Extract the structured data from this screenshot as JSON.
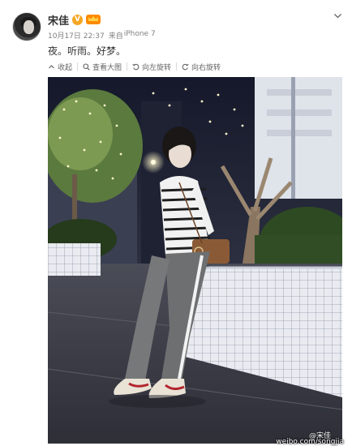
{
  "post": {
    "username": "宋佳",
    "verified_badge": "V",
    "meta": {
      "date": "10月17日 22:37",
      "source_prefix": "来自",
      "source": "iPhone 7"
    },
    "text": "夜。听雨。好梦。"
  },
  "toolbar": {
    "collapse": "收起",
    "view_large": "查看大图",
    "rotate_left": "向左旋转",
    "rotate_right": "向右旋转"
  },
  "photo": {
    "watermark_name": "@宋佳",
    "watermark_url": "weibo.com/songjia"
  },
  "colors": {
    "text": "#333333",
    "meta": "#808080",
    "verified": "#f5a623",
    "member": "#ff8a00"
  },
  "icons": [
    "avatar",
    "verified-icon",
    "member-crown-icon",
    "chevron-down-icon",
    "collapse-icon",
    "magnifier-icon",
    "rotate-left-icon",
    "rotate-right-icon"
  ]
}
